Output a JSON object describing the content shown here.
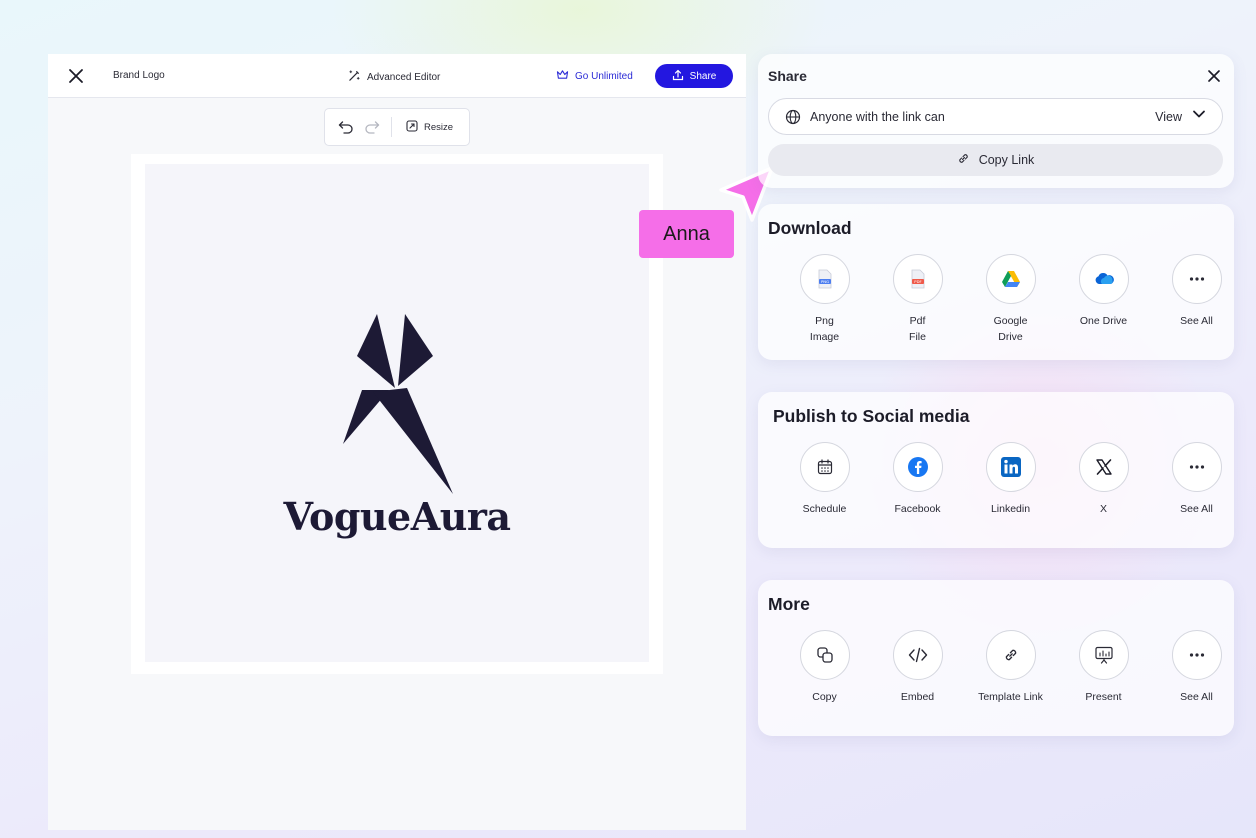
{
  "editor": {
    "brand": "Brand Logo",
    "advanced": "Advanced Editor",
    "unlimited": "Go Unlimited",
    "share_button": "Share",
    "resize": "Resize",
    "logo_word": "VogueAura"
  },
  "cursor": {
    "name": "Anna",
    "color": "#f56ee8"
  },
  "share": {
    "title": "Share",
    "link_text": "Anyone with the link can",
    "permission": "View",
    "copy_link": "Copy Link"
  },
  "download": {
    "title": "Download",
    "items": [
      {
        "label": "Png\nImage",
        "icon": "png-file-icon"
      },
      {
        "label": "Pdf\nFile",
        "icon": "pdf-file-icon"
      },
      {
        "label": "Google\nDrive",
        "icon": "google-drive-icon"
      },
      {
        "label": "One Drive",
        "icon": "onedrive-icon"
      },
      {
        "label": "See All",
        "icon": "more-icon"
      }
    ]
  },
  "social": {
    "title": "Publish to Social media",
    "items": [
      {
        "label": "Schedule",
        "icon": "calendar-icon"
      },
      {
        "label": "Facebook",
        "icon": "facebook-icon"
      },
      {
        "label": "Linkedin",
        "icon": "linkedin-icon"
      },
      {
        "label": "X",
        "icon": "x-icon"
      },
      {
        "label": "See All",
        "icon": "more-icon"
      }
    ]
  },
  "more": {
    "title": "More",
    "items": [
      {
        "label": "Copy",
        "icon": "copy-icon"
      },
      {
        "label": "Embed",
        "icon": "code-icon"
      },
      {
        "label": "Template Link",
        "icon": "link-icon"
      },
      {
        "label": "Present",
        "icon": "presentation-icon"
      },
      {
        "label": "See All",
        "icon": "more-icon"
      }
    ]
  },
  "colors": {
    "accent": "#2317e0",
    "cursor": "#f56ee8",
    "logo": "#1d1a35"
  }
}
